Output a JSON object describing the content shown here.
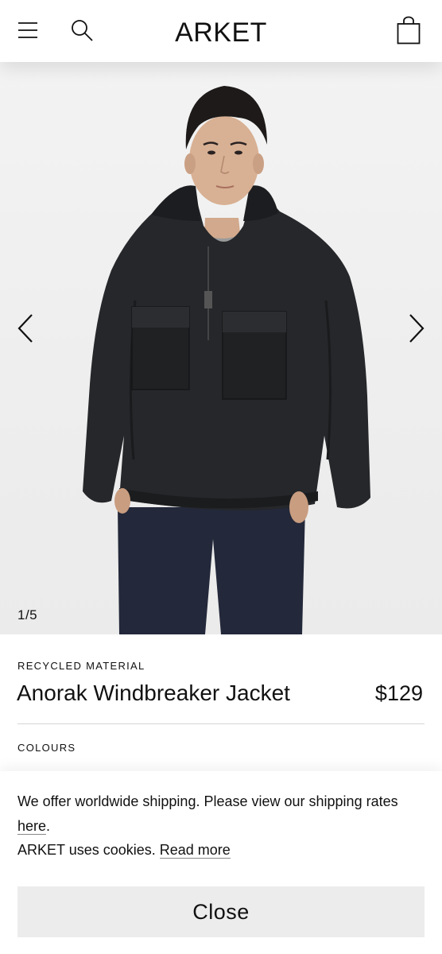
{
  "header": {
    "logo": "ARKET",
    "icons": {
      "menu": "hamburger-menu-icon",
      "search": "search-icon",
      "bag": "shopping-bag-icon"
    }
  },
  "gallery": {
    "counter": "1/5",
    "current_image": 1,
    "total_images": 5,
    "prev_icon": "chevron-left-icon",
    "next_icon": "chevron-right-icon"
  },
  "product": {
    "tag": "RECYCLED MATERIAL",
    "name": "Anorak Windbreaker Jacket",
    "price": "$129",
    "colours_label": "COLOURS"
  },
  "cookie_banner": {
    "shipping_text_before": "We offer worldwide shipping. Please view our shipping rates ",
    "shipping_link": "here",
    "shipping_text_after": ".",
    "cookies_text": "ARKET uses cookies. ",
    "cookies_link": "Read more",
    "close_label": "Close"
  }
}
